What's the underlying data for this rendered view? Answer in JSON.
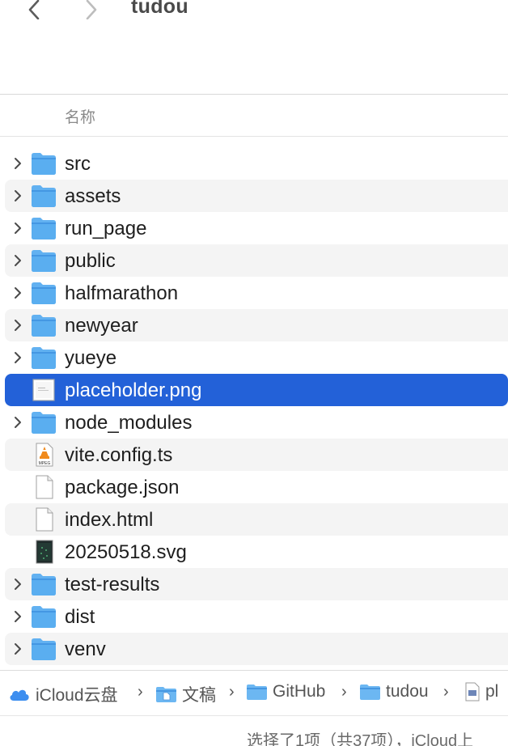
{
  "window": {
    "title": "tudou"
  },
  "header": {
    "name_column": "名称"
  },
  "files": [
    {
      "name": "src",
      "kind": "folder",
      "icon": "folder-icon",
      "expandable": true
    },
    {
      "name": "assets",
      "kind": "folder",
      "icon": "folder-icon",
      "expandable": true
    },
    {
      "name": "run_page",
      "kind": "folder",
      "icon": "folder-icon",
      "expandable": true
    },
    {
      "name": "public",
      "kind": "folder",
      "icon": "folder-icon",
      "expandable": true
    },
    {
      "name": "halfmarathon",
      "kind": "folder",
      "icon": "folder-icon",
      "expandable": true
    },
    {
      "name": "newyear",
      "kind": "folder",
      "icon": "folder-icon",
      "expandable": true
    },
    {
      "name": "yueye",
      "kind": "folder",
      "icon": "folder-icon",
      "expandable": true
    },
    {
      "name": "placeholder.png",
      "kind": "image",
      "icon": "png-file-icon",
      "expandable": false,
      "selected": true
    },
    {
      "name": "node_modules",
      "kind": "folder",
      "icon": "folder-icon",
      "expandable": true
    },
    {
      "name": "vite.config.ts",
      "kind": "mpeg",
      "icon": "mpeg-file-icon",
      "expandable": false,
      "icon_text": "MPEG"
    },
    {
      "name": "package.json",
      "kind": "document",
      "icon": "blank-document-icon",
      "expandable": false
    },
    {
      "name": "index.html",
      "kind": "document",
      "icon": "html-document-icon",
      "expandable": false
    },
    {
      "name": "20250518.svg",
      "kind": "svg",
      "icon": "svg-file-icon",
      "expandable": false
    },
    {
      "name": "test-results",
      "kind": "folder",
      "icon": "folder-icon",
      "expandable": true
    },
    {
      "name": "dist",
      "kind": "folder",
      "icon": "folder-icon",
      "expandable": true
    },
    {
      "name": "venv",
      "kind": "folder",
      "icon": "folder-icon",
      "expandable": true
    }
  ],
  "pathbar": {
    "crumbs": [
      "iCloud云盘",
      "文稿",
      "GitHub",
      "tudou",
      "pl"
    ],
    "separator": "›"
  },
  "status": {
    "text": "选择了1项（共37项），iCloud上"
  },
  "colors": {
    "selection": "#2361d8",
    "folder": "#5aaef0",
    "folder_tab": "#4497e3",
    "alt_row": "#f4f4f4"
  }
}
